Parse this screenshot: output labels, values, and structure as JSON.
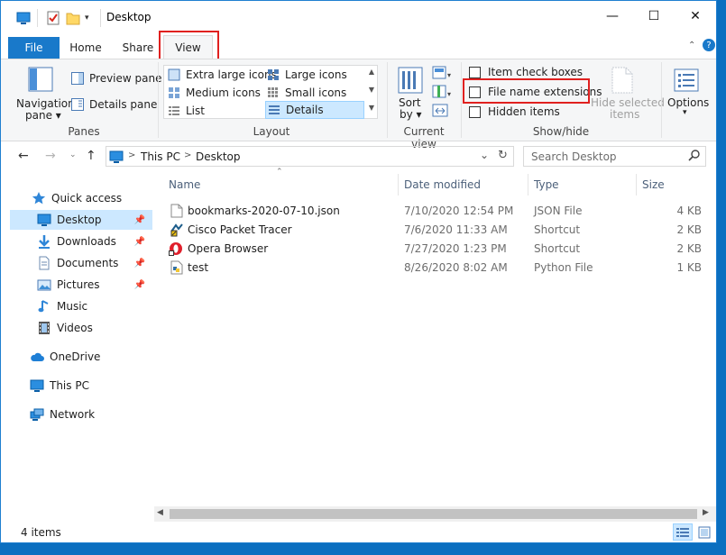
{
  "window": {
    "title": "Desktop"
  },
  "caption": {
    "minimize": "—",
    "maximize": "☐",
    "close": "✕"
  },
  "tabs": {
    "file": "File",
    "home": "Home",
    "share": "Share",
    "view": "View"
  },
  "ribbon": {
    "panes": {
      "navigation_pane": "Navigation",
      "navigation_pane2": "pane ▾",
      "preview_pane": "Preview pane",
      "details_pane": "Details pane",
      "group": "Panes"
    },
    "layout": {
      "items": [
        "Extra large icons",
        "Large icons",
        "Medium icons",
        "Small icons",
        "List",
        "Details"
      ],
      "group": "Layout"
    },
    "current_view": {
      "sort_by": "Sort",
      "sort_by2": "by ▾",
      "group": "Current view"
    },
    "show_hide": {
      "item_check_boxes": "Item check boxes",
      "file_name_extensions": "File name extensions",
      "hidden_items": "Hidden items",
      "hide_selected_items": "Hide selected",
      "hide_selected_items2": "items",
      "group": "Show/hide"
    },
    "options": {
      "label": "Options",
      "arrow": "▾"
    }
  },
  "address": {
    "this_pc": "This PC",
    "sep1": ">",
    "sep2": ">",
    "folder": "Desktop",
    "dropdown": "⌄",
    "refresh": "↻"
  },
  "search": {
    "placeholder": "Search Desktop"
  },
  "nav": {
    "quick_access": "Quick access",
    "desktop": "Desktop",
    "downloads": "Downloads",
    "documents": "Documents",
    "pictures": "Pictures",
    "music": "Music",
    "videos": "Videos",
    "onedrive": "OneDrive",
    "this_pc": "This PC",
    "network": "Network"
  },
  "columns": {
    "name": "Name",
    "date_modified": "Date modified",
    "type": "Type",
    "size": "Size"
  },
  "files": [
    {
      "name": "bookmarks-2020-07-10.json",
      "date": "7/10/2020 12:54 PM",
      "type": "JSON File",
      "size": "4 KB"
    },
    {
      "name": "Cisco Packet Tracer",
      "date": "7/6/2020 11:33 AM",
      "type": "Shortcut",
      "size": "2 KB"
    },
    {
      "name": "Opera Browser",
      "date": "7/27/2020 1:23 PM",
      "type": "Shortcut",
      "size": "2 KB"
    },
    {
      "name": "test",
      "date": "8/26/2020 8:02 AM",
      "type": "Python File",
      "size": "1 KB"
    }
  ],
  "status": {
    "items": "4 items"
  },
  "colors": {
    "accent": "#1979ca",
    "highlight": "#e0201f",
    "selection": "#cce8ff"
  }
}
